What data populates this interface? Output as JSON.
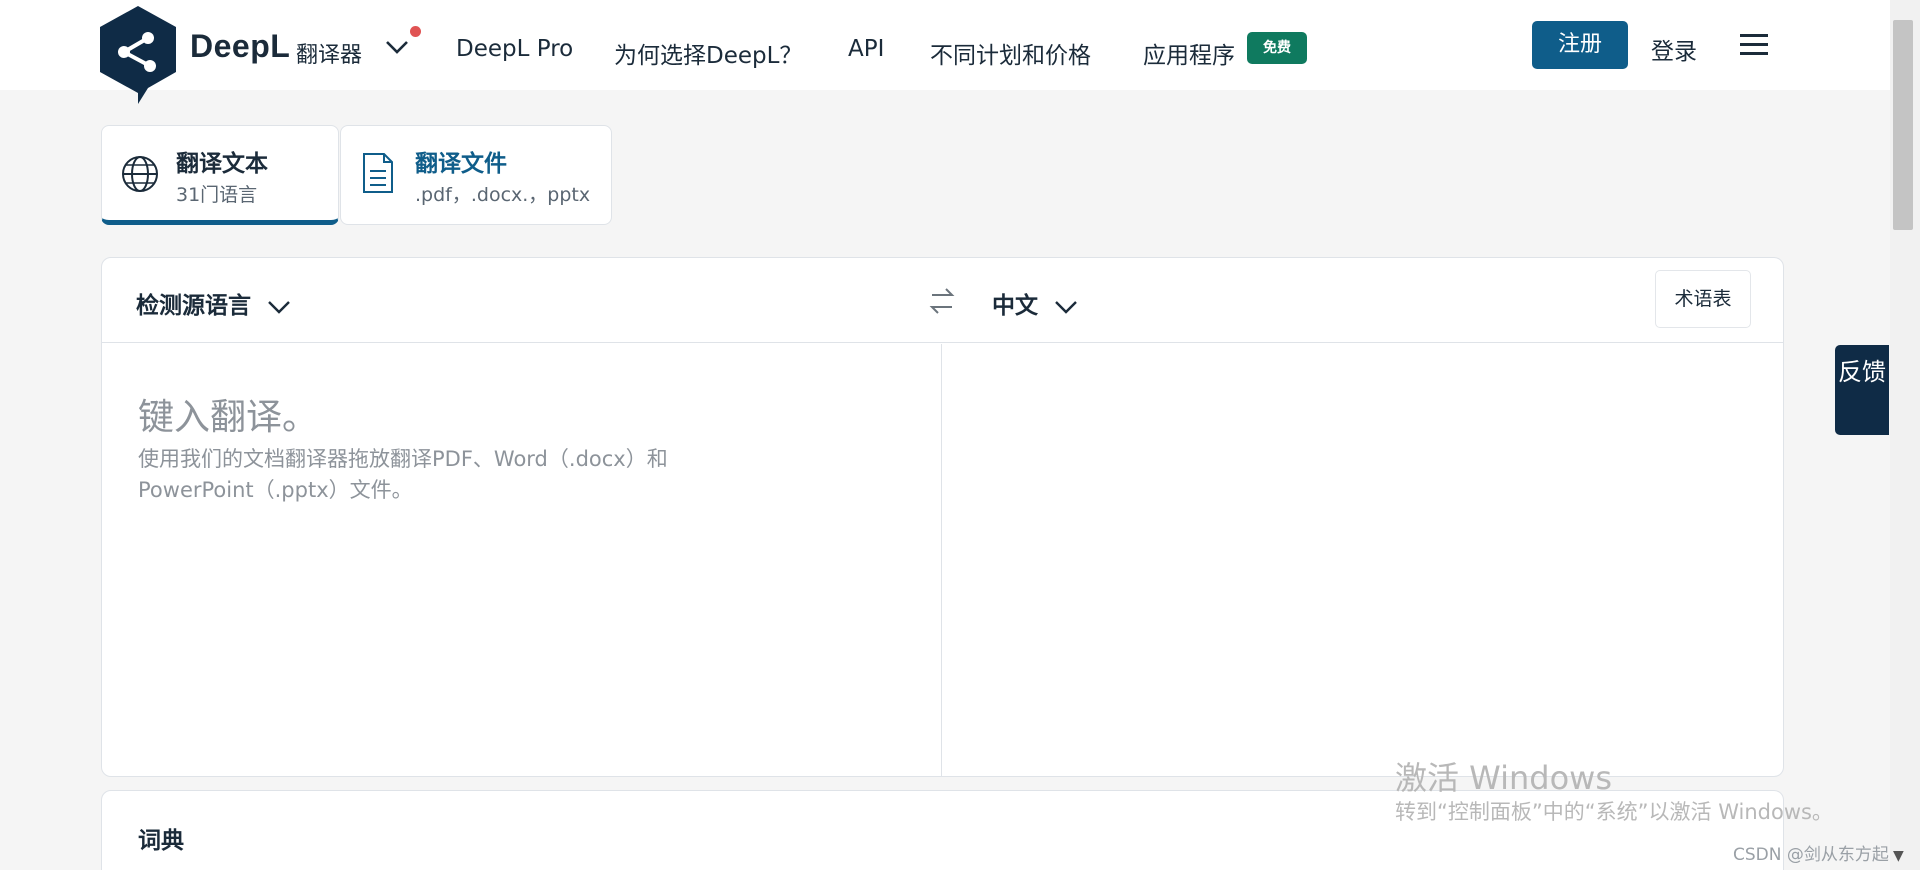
{
  "header": {
    "brand": "DeepL",
    "brand_sub": "翻译器",
    "nav": [
      "DeepL Pro",
      "为何选择DeepL？",
      "API",
      "不同计划和价格",
      "应用程序"
    ],
    "free_badge": "免费",
    "signup": "注册",
    "login": "登录"
  },
  "modes": {
    "text": {
      "title": "翻译文本",
      "subtitle": "31门语言"
    },
    "file": {
      "title": "翻译文件",
      "subtitle": ".pdf，.docx.，pptx"
    }
  },
  "translator": {
    "source_lang": "检测源语言",
    "target_lang": "中文",
    "glossary": "术语表",
    "placeholder": "键入翻译。",
    "hint": "使用我们的文档翻译器拖放翻译PDF、Word（.docx）和PowerPoint（.pptx）文件。"
  },
  "dictionary": {
    "title": "词典"
  },
  "feedback": {
    "label": "反馈"
  },
  "watermark": {
    "line1": "激活 Windows",
    "line2": "转到“控制面板”中的“系统”以激活 Windows。",
    "csdn": "CSDN @剑从东方起"
  },
  "colors": {
    "primary": "#0f5d8a",
    "badge": "#0f7a5f",
    "dark": "#0f2b46",
    "dot": "#e05353"
  },
  "icons": [
    "deepl-logo-icon",
    "chevron-down-icon",
    "menu-icon",
    "globe-icon",
    "document-icon",
    "swap-icon"
  ]
}
